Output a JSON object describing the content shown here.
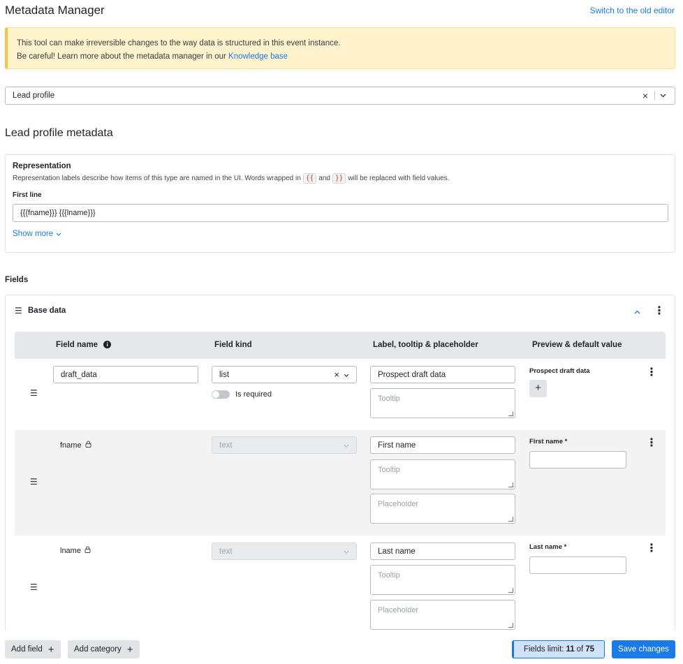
{
  "header": {
    "title": "Metadata Manager",
    "old_editor_link": "Switch to the old editor"
  },
  "warning": {
    "line1": "This tool can make irreversible changes to the way data is structured in this event instance.",
    "line2_prefix": "Be careful! Learn more about the metadata manager in our",
    "link": "Knowledge base"
  },
  "profile_select": {
    "value": "Lead profile",
    "clear_icon": "×",
    "chevron_icon": "⌄"
  },
  "section_title": "Lead profile metadata",
  "representation": {
    "title": "Representation",
    "desc_part1": "Representation labels describe how items of this type are named in the UI. Words wrapped in",
    "open_chip": "{{",
    "desc_and": "and",
    "close_chip": "}}",
    "desc_part2": "will be replaced with field values.",
    "first_line_label": "First line",
    "first_line_value": "{{{fname}}} {{{lname}}}",
    "show_more": "Show more"
  },
  "fields_label": "Fields",
  "category": {
    "name": "Base data",
    "columns": [
      "Field name",
      "Field kind",
      "Label, tooltip & placeholder",
      "Preview & default value"
    ],
    "rows": [
      {
        "name": "draft_data",
        "kind": "list",
        "is_required_label": "Is required",
        "label": "Prospect draft data",
        "tooltip_placeholder": "Tooltip",
        "preview_label": "Prospect draft data"
      },
      {
        "name": "fname",
        "kind": "text",
        "label": "First name",
        "tooltip_placeholder": "Tooltip",
        "placeholder_placeholder": "Placeholder",
        "preview_label": "First name *"
      },
      {
        "name": "lname",
        "kind": "text",
        "label": "Last name",
        "tooltip_placeholder": "Tooltip",
        "placeholder_placeholder": "Placeholder",
        "preview_label": "Last name *"
      }
    ]
  },
  "footer": {
    "add_field": "Add field",
    "add_category": "Add category",
    "limit_prefix": "Fields limit:",
    "limit_used": "11",
    "limit_of": "of",
    "limit_total": "75",
    "save": "Save changes"
  }
}
